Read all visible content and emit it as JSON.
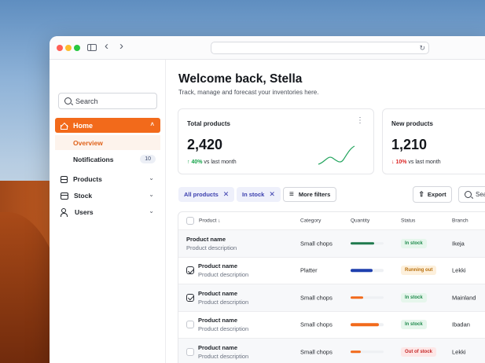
{
  "app": {
    "welcome_title": "Welcome back, Stella",
    "welcome_subtitle": "Track, manage and forecast your inventories here."
  },
  "browser": {
    "reload_glyph": "↻",
    "back_glyph": "‹",
    "forward_glyph": "›"
  },
  "sidebar": {
    "search_placeholder": "Search",
    "home_label": "Home",
    "overview_label": "Overview",
    "notifications_label": "Notifications",
    "notifications_count": "10",
    "products_label": "Products",
    "stock_label": "Stock",
    "users_label": "Users",
    "chevron_glyph": "⌄",
    "chevron_up_glyph": "˄"
  },
  "cards": {
    "total": {
      "label": "Total products",
      "value": "2,420",
      "change": "↑ 40%",
      "change_text": "vs last month",
      "menu_glyph": "⋮"
    },
    "new": {
      "label": "New products",
      "value": "1,210",
      "change": "↓ 10%",
      "change_text": "vs last month"
    }
  },
  "filters": {
    "chips": [
      {
        "label": "All products",
        "remove": "✕"
      },
      {
        "label": "In stock",
        "remove": "✕"
      }
    ],
    "more_label": "More filters",
    "more_icon": "≡",
    "export_label": "Export",
    "export_icon": "⇧",
    "search_placeholder": "Sea"
  },
  "table": {
    "headers": {
      "product": "Product ↓",
      "category": "Category",
      "quantity": "Quantity",
      "status": "Status",
      "branch": "Branch"
    },
    "rows": [
      {
        "name": "Product name",
        "desc": "Product description",
        "category": "Small chops",
        "qty": 0.72,
        "qty_color": "#1f7a4d",
        "status": "In stock",
        "branch": "Ikeja"
      },
      {
        "name": "Product name",
        "desc": "Product description",
        "category": "Platter",
        "qty": 0.66,
        "qty_color": "#1e3fae",
        "status": "Running out",
        "branch": "Lekki"
      },
      {
        "name": "Product name",
        "desc": "Product description",
        "category": "Small chops",
        "qty": 0.38,
        "qty_color": "#f26a1b",
        "status": "In stock",
        "branch": "Mainland"
      },
      {
        "name": "Product name",
        "desc": "Product description",
        "category": "Small chops",
        "qty": 0.85,
        "qty_color": "#f26a1b",
        "status": "In stock",
        "branch": "Ibadan"
      },
      {
        "name": "Product name",
        "desc": "Product description",
        "category": "Small chops",
        "qty": 0.3,
        "qty_color": "#f26a1b",
        "status": "Out of stock",
        "branch": "Lekki"
      }
    ]
  },
  "colors": {
    "accent": "#f26a1b",
    "in_stock_bg": "#e6f6ec",
    "in_stock_fg": "#1f8a4c",
    "running_out_bg": "#fdf0dc",
    "running_out_fg": "#b86e0a",
    "out_of_stock_bg": "#fde7e7",
    "out_of_stock_fg": "#c62828"
  }
}
